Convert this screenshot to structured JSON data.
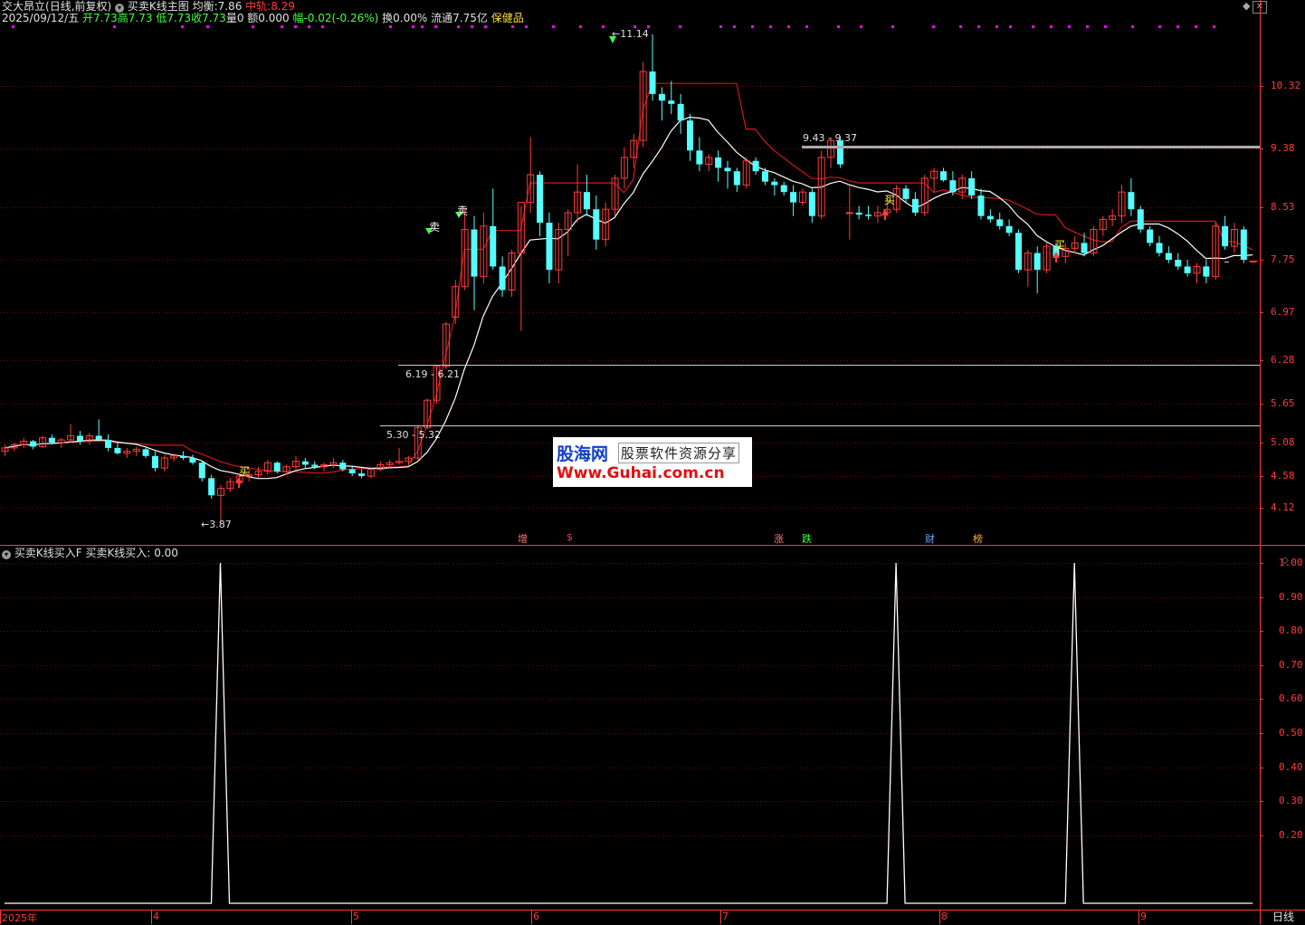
{
  "header": {
    "stock_name": "交大昂立",
    "period_mode": "(日线,前复权)",
    "indicator_name": "买卖K线主图",
    "avg_label": "均衡:",
    "avg_value": "7.86",
    "mid_label": "中轨:",
    "mid_value": "8.29"
  },
  "quote": {
    "date": "2025/09/12/五",
    "open": "开7.73",
    "high": "高7.73",
    "low": "低7.73",
    "close": "收7.73",
    "volume": "量0",
    "amount": "额0.000",
    "change": "幅-0.02(-0.26%)",
    "turnover": "换0.00%",
    "float_cap": "流通7.75亿",
    "sector": "保健品"
  },
  "colors": {
    "up": "#ff3b3b",
    "down": "#54ffff",
    "ma": "#ffffff",
    "band": "#d01818",
    "grid": "#7a0000",
    "magenta": "#ff00ff"
  },
  "price_axis": [
    "10.32",
    "9.38",
    "8.53",
    "7.75",
    "6.97",
    "6.28",
    "5.65",
    "5.08",
    "4.58",
    "4.12"
  ],
  "annotations": {
    "high_mark": "11.14",
    "low_mark": "3.87",
    "box1": "9.43 - 9.37",
    "box2": "6.19 - 6.21",
    "box3": "5.30 - 5.32",
    "sell1": "卖",
    "sell2": "卖",
    "buy1": "买",
    "buy2": "买",
    "buy3": "买"
  },
  "event_tags": [
    {
      "text": "增",
      "color": "#ff7777"
    },
    {
      "text": "$",
      "color": "#ff3b3b"
    },
    {
      "text": "涨",
      "color": "#ff7777"
    },
    {
      "text": "跌",
      "color": "#44ff44"
    },
    {
      "text": "财",
      "color": "#66aaff"
    },
    {
      "text": "榜",
      "color": "#ffaa44"
    }
  ],
  "sub_panel": {
    "title": "买卖K线买入F",
    "series_label": "买卖K线买入:",
    "series_value": "0.00",
    "axis": [
      "1.00",
      "0.90",
      "0.80",
      "0.70",
      "0.60",
      "0.50",
      "0.40",
      "0.30",
      "0.20"
    ]
  },
  "time_axis": [
    "2025年",
    "4",
    "5",
    "6",
    "7",
    "8",
    "9"
  ],
  "period_button": "日线",
  "watermark": {
    "logo": "股海网",
    "slogan": "股票软件资源分享",
    "url": "Www.Guhai.com.cn"
  },
  "chart_data": [
    {
      "type": "candlestick",
      "title": "买卖K线主图",
      "ylim": [
        3.87,
        11.14
      ],
      "y_ticks": [
        10.32,
        9.38,
        8.53,
        7.75,
        6.97,
        6.28,
        5.65,
        5.08,
        4.58,
        4.12
      ],
      "ohlc": [
        [
          4.95,
          5.05,
          4.88,
          5.0
        ],
        [
          5.0,
          5.08,
          4.95,
          5.05
        ],
        [
          5.05,
          5.15,
          5.0,
          5.1
        ],
        [
          5.1,
          5.12,
          4.98,
          5.02
        ],
        [
          5.02,
          5.18,
          5.0,
          5.15
        ],
        [
          5.15,
          5.2,
          5.05,
          5.08
        ],
        [
          5.08,
          5.15,
          5.0,
          5.12
        ],
        [
          5.12,
          5.35,
          5.08,
          5.18
        ],
        [
          5.18,
          5.25,
          5.05,
          5.1
        ],
        [
          5.1,
          5.22,
          5.05,
          5.18
        ],
        [
          5.18,
          5.42,
          5.1,
          5.12
        ],
        [
          5.12,
          5.2,
          4.95,
          5.0
        ],
        [
          5.0,
          5.08,
          4.9,
          4.92
        ],
        [
          4.92,
          5.0,
          4.85,
          4.95
        ],
        [
          4.95,
          5.02,
          4.88,
          4.98
        ],
        [
          4.98,
          5.0,
          4.85,
          4.88
        ],
        [
          4.88,
          4.95,
          4.65,
          4.7
        ],
        [
          4.7,
          4.9,
          4.65,
          4.85
        ],
        [
          4.85,
          4.92,
          4.8,
          4.88
        ],
        [
          4.88,
          4.95,
          4.82,
          4.85
        ],
        [
          4.85,
          4.9,
          4.75,
          4.78
        ],
        [
          4.78,
          4.8,
          4.5,
          4.55
        ],
        [
          4.55,
          4.6,
          4.25,
          4.3
        ],
        [
          4.3,
          4.45,
          3.87,
          4.4
        ],
        [
          4.4,
          4.55,
          4.35,
          4.5
        ],
        [
          4.5,
          4.6,
          4.45,
          4.58
        ],
        [
          4.58,
          4.7,
          4.5,
          4.6
        ],
        [
          4.6,
          4.72,
          4.55,
          4.65
        ],
        [
          4.65,
          4.82,
          4.6,
          4.78
        ],
        [
          4.78,
          4.8,
          4.62,
          4.65
        ],
        [
          4.65,
          4.75,
          4.6,
          4.72
        ],
        [
          4.72,
          4.88,
          4.68,
          4.8
        ],
        [
          4.8,
          4.85,
          4.7,
          4.75
        ],
        [
          4.75,
          4.8,
          4.68,
          4.72
        ],
        [
          4.72,
          4.78,
          4.65,
          4.75
        ],
        [
          4.75,
          4.85,
          4.7,
          4.78
        ],
        [
          4.78,
          4.82,
          4.65,
          4.68
        ],
        [
          4.68,
          4.72,
          4.58,
          4.62
        ],
        [
          4.62,
          4.68,
          4.55,
          4.58
        ],
        [
          4.58,
          4.72,
          4.55,
          4.68
        ],
        [
          4.68,
          4.8,
          4.65,
          4.75
        ],
        [
          4.75,
          4.82,
          4.7,
          4.78
        ],
        [
          4.78,
          5.0,
          4.75,
          4.8
        ],
        [
          4.8,
          4.88,
          4.75,
          4.85
        ],
        [
          4.85,
          5.32,
          4.82,
          5.3
        ],
        [
          5.3,
          5.72,
          5.28,
          5.7
        ],
        [
          5.7,
          6.21,
          5.65,
          6.19
        ],
        [
          6.19,
          6.83,
          6.15,
          6.8
        ],
        [
          6.9,
          7.45,
          6.8,
          7.35
        ],
        [
          7.35,
          8.5,
          7.3,
          8.2
        ],
        [
          8.2,
          8.4,
          7.0,
          7.5
        ],
        [
          7.5,
          8.45,
          7.4,
          8.25
        ],
        [
          8.25,
          8.8,
          7.6,
          7.65
        ],
        [
          7.65,
          7.8,
          7.2,
          7.3
        ],
        [
          7.3,
          7.9,
          7.2,
          7.85
        ],
        [
          7.85,
          8.55,
          6.7,
          8.6
        ],
        [
          8.6,
          9.55,
          8.45,
          9.0
        ],
        [
          9.0,
          9.05,
          8.1,
          8.3
        ],
        [
          8.3,
          8.45,
          7.4,
          7.6
        ],
        [
          7.6,
          8.3,
          7.4,
          8.2
        ],
        [
          8.2,
          8.5,
          7.8,
          8.45
        ],
        [
          8.45,
          9.15,
          8.3,
          8.75
        ],
        [
          8.75,
          9.0,
          8.4,
          8.5
        ],
        [
          8.5,
          8.7,
          7.9,
          8.05
        ],
        [
          8.05,
          8.6,
          7.95,
          8.5
        ],
        [
          8.5,
          9.0,
          8.4,
          8.95
        ],
        [
          8.95,
          9.4,
          8.8,
          9.25
        ],
        [
          9.25,
          9.6,
          9.1,
          9.5
        ],
        [
          9.5,
          10.7,
          9.4,
          10.55
        ],
        [
          10.55,
          11.14,
          10.1,
          10.2
        ],
        [
          10.2,
          10.3,
          9.8,
          10.1
        ],
        [
          10.1,
          10.4,
          9.9,
          10.05
        ],
        [
          10.05,
          10.2,
          9.6,
          9.8
        ],
        [
          9.8,
          9.9,
          9.2,
          9.35
        ],
        [
          9.35,
          9.55,
          9.05,
          9.15
        ],
        [
          9.15,
          9.3,
          9.05,
          9.25
        ],
        [
          9.25,
          9.35,
          8.9,
          9.1
        ],
        [
          9.1,
          9.2,
          8.8,
          9.05
        ],
        [
          9.05,
          9.1,
          8.75,
          8.85
        ],
        [
          8.85,
          9.25,
          8.8,
          9.2
        ],
        [
          9.2,
          9.25,
          9.0,
          9.05
        ],
        [
          9.05,
          9.1,
          8.85,
          8.9
        ],
        [
          8.9,
          8.95,
          8.7,
          8.85
        ],
        [
          8.85,
          8.9,
          8.7,
          8.75
        ],
        [
          8.75,
          8.85,
          8.4,
          8.6
        ],
        [
          8.6,
          8.8,
          8.55,
          8.75
        ],
        [
          8.75,
          8.8,
          8.3,
          8.4
        ],
        [
          8.4,
          9.35,
          8.35,
          9.25
        ],
        [
          9.25,
          9.55,
          9.1,
          9.5
        ],
        [
          9.5,
          9.55,
          9.1,
          9.15
        ],
        [
          8.45,
          8.85,
          8.05,
          8.45
        ],
        [
          8.45,
          8.55,
          8.35,
          8.42
        ],
        [
          8.42,
          8.55,
          8.35,
          8.4
        ],
        [
          8.4,
          8.55,
          8.3,
          8.45
        ],
        [
          8.45,
          8.7,
          8.4,
          8.5
        ],
        [
          8.5,
          8.85,
          8.45,
          8.8
        ],
        [
          8.8,
          8.85,
          8.6,
          8.65
        ],
        [
          8.65,
          8.75,
          8.4,
          8.45
        ],
        [
          8.45,
          9.0,
          8.4,
          8.95
        ],
        [
          8.95,
          9.1,
          8.75,
          9.05
        ],
        [
          9.05,
          9.1,
          8.9,
          8.92
        ],
        [
          8.92,
          9.05,
          8.7,
          8.75
        ],
        [
          8.75,
          9.0,
          8.65,
          8.95
        ],
        [
          8.95,
          9.05,
          8.65,
          8.7
        ],
        [
          8.7,
          8.8,
          8.35,
          8.4
        ],
        [
          8.4,
          8.5,
          8.3,
          8.35
        ],
        [
          8.35,
          8.45,
          8.2,
          8.25
        ],
        [
          8.25,
          8.35,
          8.1,
          8.15
        ],
        [
          8.15,
          8.2,
          7.55,
          7.6
        ],
        [
          7.6,
          7.9,
          7.35,
          7.85
        ],
        [
          7.85,
          7.95,
          7.25,
          7.6
        ],
        [
          7.6,
          8.0,
          7.55,
          7.95
        ],
        [
          7.95,
          8.0,
          7.75,
          7.8
        ],
        [
          7.8,
          8.0,
          7.7,
          7.92
        ],
        [
          7.92,
          8.1,
          7.85,
          8.0
        ],
        [
          8.0,
          8.15,
          7.8,
          7.85
        ],
        [
          7.85,
          8.25,
          7.8,
          8.2
        ],
        [
          8.2,
          8.4,
          8.1,
          8.35
        ],
        [
          8.35,
          8.5,
          8.25,
          8.4
        ],
        [
          8.4,
          8.85,
          8.3,
          8.75
        ],
        [
          8.75,
          8.95,
          8.4,
          8.5
        ],
        [
          8.5,
          8.55,
          8.15,
          8.2
        ],
        [
          8.2,
          8.25,
          7.95,
          8.0
        ],
        [
          8.0,
          8.1,
          7.8,
          7.85
        ],
        [
          7.85,
          7.95,
          7.7,
          7.75
        ],
        [
          7.75,
          7.85,
          7.6,
          7.65
        ],
        [
          7.65,
          7.75,
          7.5,
          7.55
        ],
        [
          7.55,
          7.7,
          7.4,
          7.65
        ],
        [
          7.65,
          7.75,
          7.4,
          7.5
        ],
        [
          7.5,
          8.3,
          7.45,
          8.25
        ],
        [
          8.25,
          8.4,
          7.9,
          7.95
        ],
        [
          7.95,
          8.3,
          7.85,
          8.2
        ],
        [
          8.2,
          8.25,
          7.7,
          7.75
        ],
        [
          7.73,
          7.73,
          7.73,
          7.73
        ]
      ]
    },
    {
      "type": "line",
      "title": "买卖K线买入F",
      "ylim": [
        0,
        1.05
      ],
      "y_ticks": [
        1.0,
        0.9,
        0.8,
        0.7,
        0.6,
        0.5,
        0.4,
        0.3,
        0.2
      ],
      "spikes": [
        {
          "category_index": 23,
          "value": 1.0
        },
        {
          "category_index": 95,
          "value": 1.0
        },
        {
          "category_index": 114,
          "value": 1.0
        }
      ],
      "baseline": 0.0
    }
  ]
}
